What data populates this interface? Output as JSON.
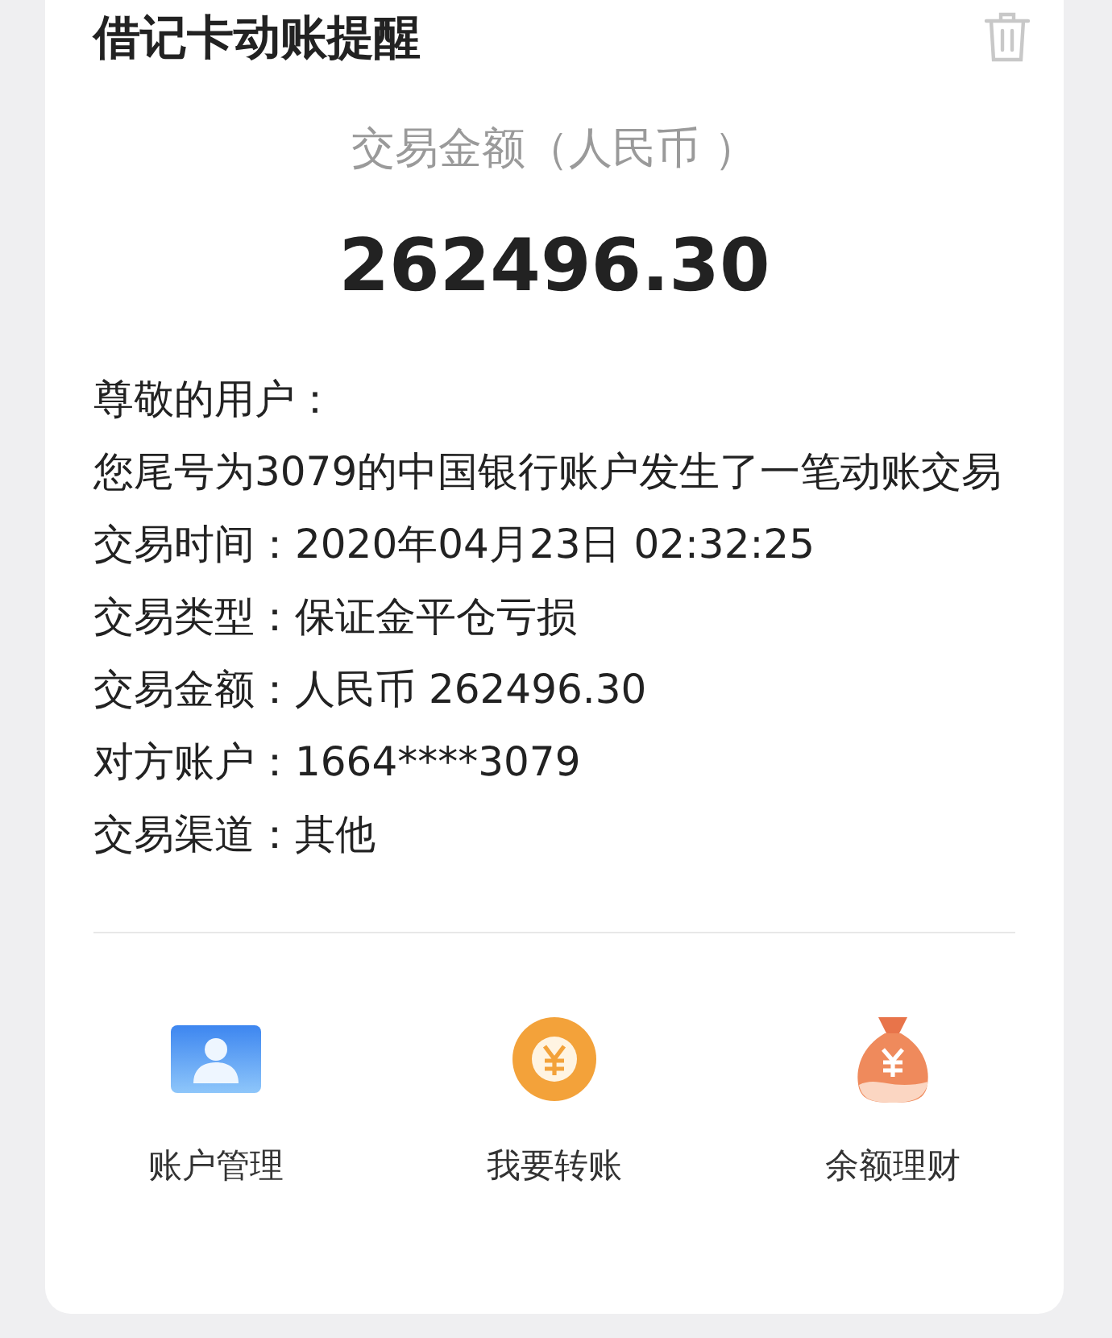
{
  "card": {
    "title": "借记卡动账提醒",
    "amount_caption": "交易金额（人民币 ）",
    "amount": "262496.30",
    "greeting": "尊敬的用户：",
    "message": "您尾号为3079的中国银行账户发生了一笔动账交易",
    "details": [
      {
        "label": "交易时间：",
        "value": "2020年04月23日 02:32:25"
      },
      {
        "label": "交易类型：",
        "value": "保证金平仓亏损"
      },
      {
        "label": "交易金额：",
        "value": "人民币 262496.30"
      },
      {
        "label": "对方账户：",
        "value": "1664****3079"
      },
      {
        "label": "交易渠道：",
        "value": "其他"
      }
    ],
    "actions": [
      {
        "kind": "account",
        "label": "账户管理"
      },
      {
        "kind": "transfer",
        "label": "我要转账"
      },
      {
        "kind": "wealth",
        "label": "余额理财"
      }
    ]
  }
}
